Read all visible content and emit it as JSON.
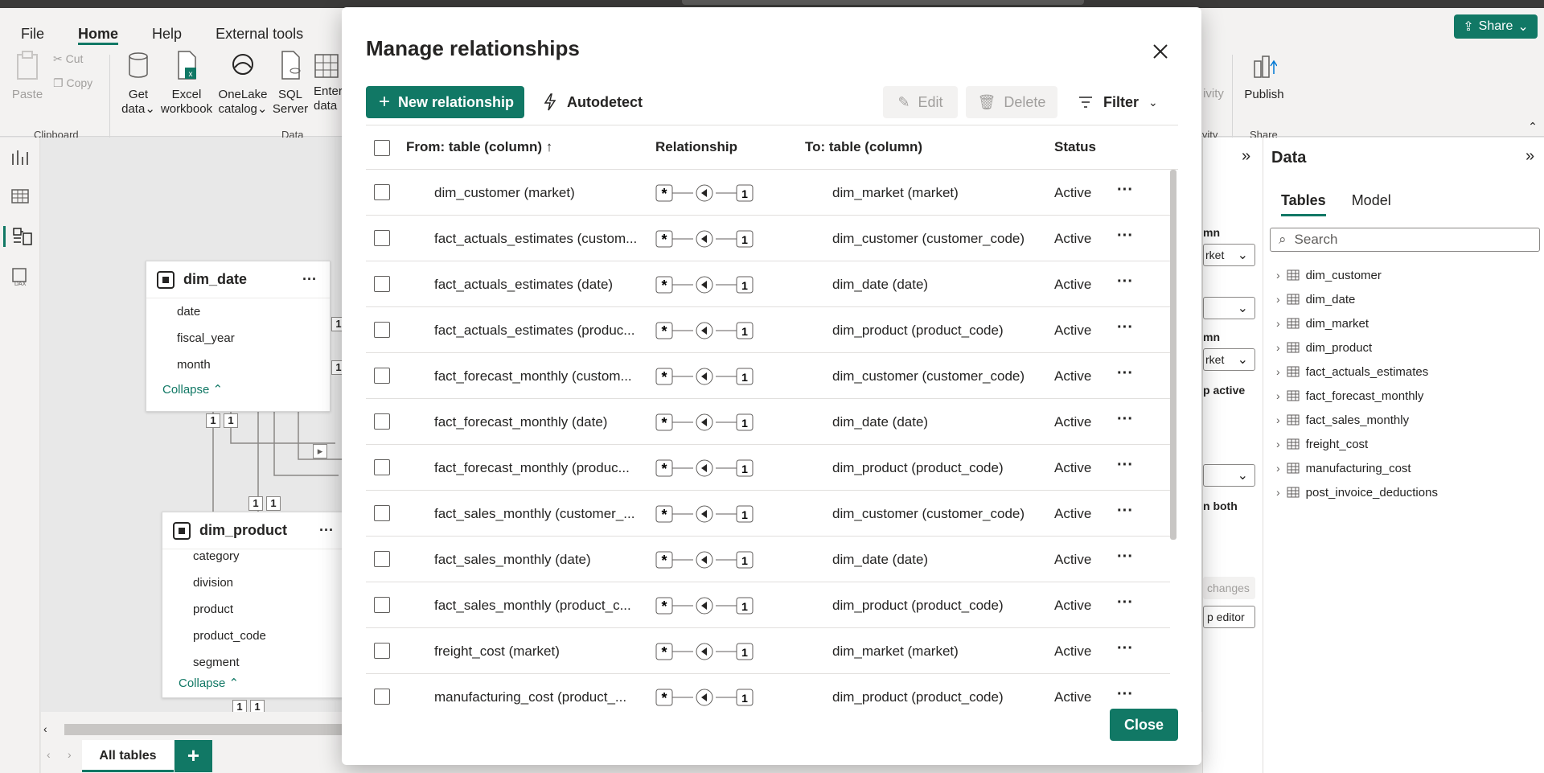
{
  "ribbon": {
    "tabs": [
      "File",
      "Home",
      "Help",
      "External tools"
    ],
    "active_tab": "Home",
    "share_label": "Share",
    "clipboard": {
      "paste": "Paste",
      "cut": "Cut",
      "copy": "Copy",
      "group": "Clipboard"
    },
    "data": {
      "get_data": [
        "Get",
        "data"
      ],
      "excel": [
        "Excel",
        "workbook"
      ],
      "onelake": [
        "OneLake",
        "catalog"
      ],
      "sql": [
        "SQL",
        "Server"
      ],
      "enter": [
        "Enter",
        "data"
      ],
      "group": "Data"
    },
    "relationships_group": "ivity",
    "publish": {
      "label": "Publish",
      "group": "Share"
    }
  },
  "canvas": {
    "dim_date": {
      "title": "dim_date",
      "fields": [
        "date",
        "fiscal_year",
        "month"
      ],
      "collapse": "Collapse"
    },
    "dim_product": {
      "title": "dim_product",
      "fields": [
        "category",
        "division",
        "product",
        "product_code",
        "segment"
      ],
      "collapse": "Collapse"
    },
    "page_tab": "All tables",
    "badge": "1"
  },
  "properties_panel": {
    "col1": "mn",
    "dd1": "rket",
    "col2": "mn",
    "dd2": "rket",
    "active": "p active",
    "both": "n both",
    "apply": "changes",
    "editor": "p editor"
  },
  "data_pane": {
    "title": "Data",
    "tabs": [
      "Tables",
      "Model"
    ],
    "active_tab": "Tables",
    "search_placeholder": "Search",
    "tables": [
      "dim_customer",
      "dim_date",
      "dim_market",
      "dim_product",
      "fact_actuals_estimates",
      "fact_forecast_monthly",
      "fact_sales_monthly",
      "freight_cost",
      "manufacturing_cost",
      "post_invoice_deductions"
    ]
  },
  "modal": {
    "title": "Manage relationships",
    "new_relationship": "New relationship",
    "autodetect": "Autodetect",
    "edit": "Edit",
    "delete": "Delete",
    "filter": "Filter",
    "close": "Close",
    "columns": {
      "from": "From: table (column)",
      "relationship": "Relationship",
      "to": "To: table (column)",
      "status": "Status"
    },
    "rel_many": "*",
    "rel_one": "1",
    "rows": [
      {
        "from": "dim_customer (market)",
        "to": "dim_market (market)",
        "status": "Active"
      },
      {
        "from": "fact_actuals_estimates (custom...",
        "to": "dim_customer (customer_code)",
        "status": "Active"
      },
      {
        "from": "fact_actuals_estimates (date)",
        "to": "dim_date (date)",
        "status": "Active"
      },
      {
        "from": "fact_actuals_estimates (produc...",
        "to": "dim_product (product_code)",
        "status": "Active"
      },
      {
        "from": "fact_forecast_monthly (custom...",
        "to": "dim_customer (customer_code)",
        "status": "Active"
      },
      {
        "from": "fact_forecast_monthly (date)",
        "to": "dim_date (date)",
        "status": "Active"
      },
      {
        "from": "fact_forecast_monthly (produc...",
        "to": "dim_product (product_code)",
        "status": "Active"
      },
      {
        "from": "fact_sales_monthly (customer_...",
        "to": "dim_customer (customer_code)",
        "status": "Active"
      },
      {
        "from": "fact_sales_monthly (date)",
        "to": "dim_date (date)",
        "status": "Active"
      },
      {
        "from": "fact_sales_monthly (product_c...",
        "to": "dim_product (product_code)",
        "status": "Active"
      },
      {
        "from": "freight_cost (market)",
        "to": "dim_market (market)",
        "status": "Active"
      },
      {
        "from": "manufacturing_cost (product_...",
        "to": "dim_product (product_code)",
        "status": "Active"
      }
    ]
  },
  "colors": {
    "accent": "#117865",
    "text": "#252423",
    "disabled": "#a19f9d"
  }
}
